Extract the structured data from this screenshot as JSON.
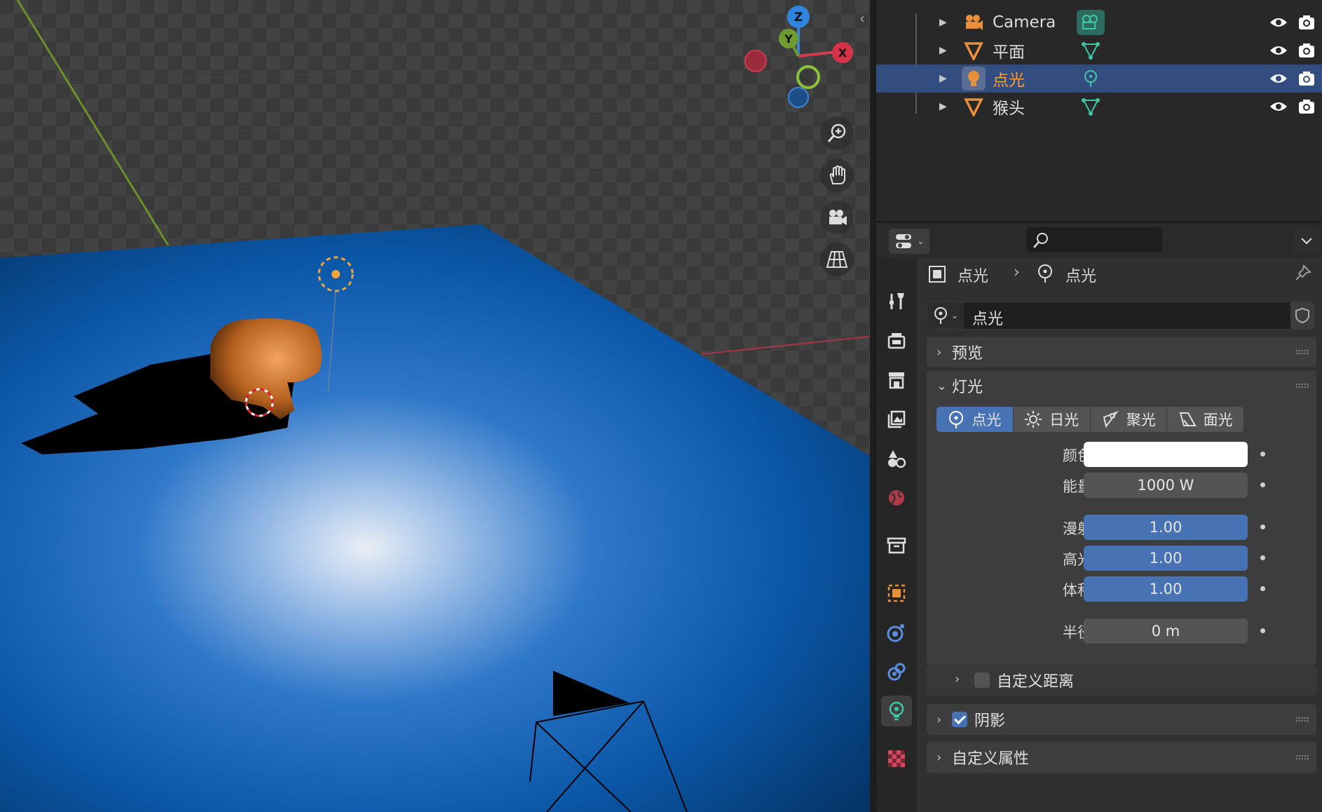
{
  "viewport": {
    "axis_labels": {
      "z": "Z",
      "y": "Y",
      "x": "X"
    },
    "nav_buttons": [
      {
        "name": "zoom-icon"
      },
      {
        "name": "hand-pan-icon"
      },
      {
        "name": "camera-view-icon"
      },
      {
        "name": "grid-perspective-icon"
      }
    ]
  },
  "outliner": {
    "items": [
      {
        "label": "Camera",
        "icon": "camera-object-icon",
        "data_icon": "camera-data-icon",
        "selected": false
      },
      {
        "label": "平面",
        "icon": "mesh-object-icon",
        "data_icon": "mesh-data-icon",
        "selected": false
      },
      {
        "label": "点光",
        "icon": "light-object-icon",
        "data_icon": "light-data-icon",
        "selected": true
      },
      {
        "label": "猴头",
        "icon": "mesh-object-icon",
        "data_icon": "mesh-data-icon",
        "selected": false
      }
    ]
  },
  "properties": {
    "breadcrumb": {
      "object": "点光",
      "data": "点光"
    },
    "data_name": "点光",
    "panels": {
      "preview": "预览",
      "light": "灯光",
      "shadow": "阴影",
      "custom_props": "自定义属性"
    },
    "light_types": [
      "点光",
      "日光",
      "聚光",
      "面光"
    ],
    "active_light_type": "点光",
    "fields": {
      "color_label": "颜色",
      "energy_label": "能量",
      "energy_value": "1000 W",
      "diffuse_label": "漫射",
      "diffuse_value": "1.00",
      "specular_label": "高光",
      "specular_value": "1.00",
      "volume_label": "体积",
      "volume_value": "1.00",
      "radius_label": "半径",
      "radius_value": "0 m"
    },
    "custom_distance": {
      "label": "自定义距离",
      "checked": false
    },
    "shadow_checked": true
  },
  "colors": {
    "accent_blue": "#4772b3",
    "selected_row": "#334d80",
    "selected_text": "#ff9d2e",
    "mesh_icon": "#e8913a",
    "data_icon": "#3dc7a5"
  }
}
